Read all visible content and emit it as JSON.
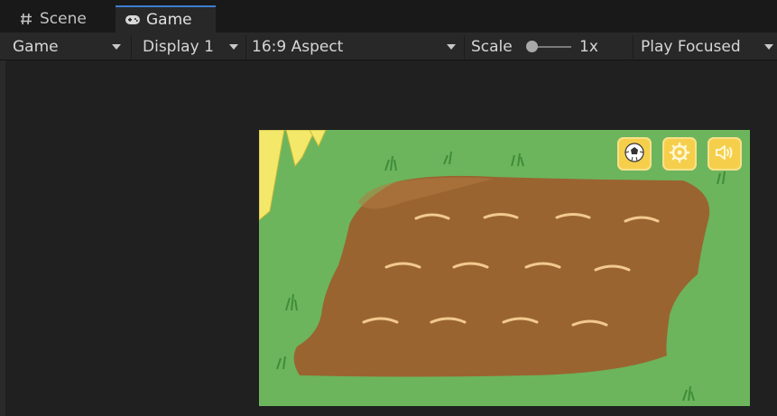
{
  "tabs": {
    "scene_label": "Scene",
    "game_label": "Game"
  },
  "toolbar": {
    "game_dropdown": "Game",
    "display_dropdown": "Display 1",
    "aspect_dropdown": "16:9 Aspect",
    "scale_label": "Scale",
    "scale_value": "1x",
    "play_mode_dropdown": "Play Focused"
  },
  "game_view": {
    "buttons": [
      "ball-icon",
      "gear-icon",
      "speaker-icon"
    ],
    "colors": {
      "grass": "#6cb55c",
      "soil": "#9a6430",
      "button": "#f5cf4b"
    }
  }
}
